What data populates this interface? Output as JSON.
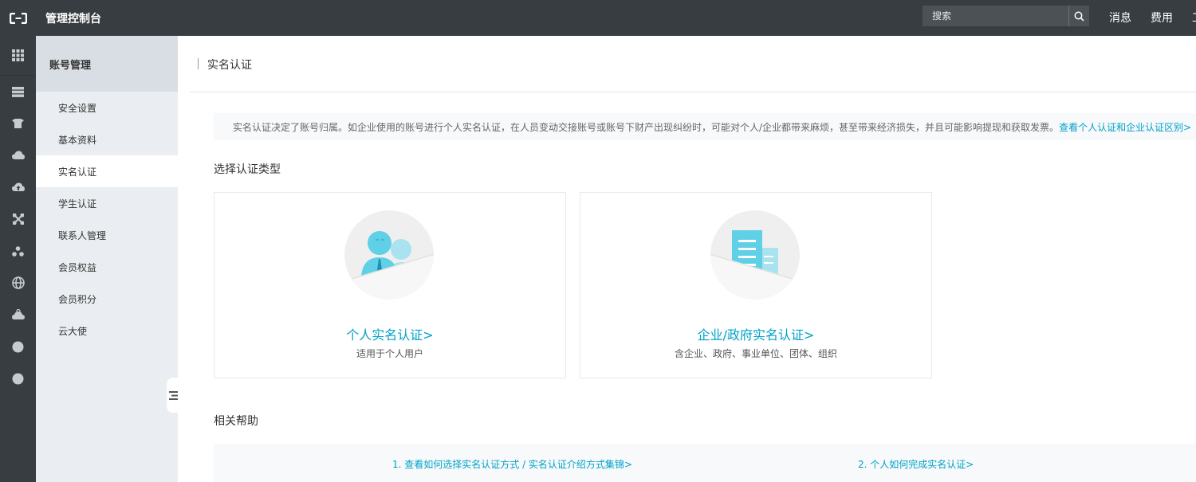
{
  "topbar": {
    "title": "管理控制台",
    "search": {
      "placeholder": "搜索"
    },
    "links": [
      "消息",
      "费用",
      "工"
    ]
  },
  "rail": {
    "icons": [
      "apps-grid-icon",
      "server-icon",
      "shield-icon",
      "cloud-icon",
      "cloud-upload-icon",
      "network-icon",
      "cluster-icon",
      "globe-icon",
      "gear-cloud-icon",
      "circle-icon",
      "circle-icon"
    ]
  },
  "subnav": {
    "header": "账号管理",
    "items": [
      "安全设置",
      "基本资料",
      "实名认证",
      "学生认证",
      "联系人管理",
      "会员权益",
      "会员积分",
      "云大使"
    ],
    "active_index": 2
  },
  "page": {
    "title": "实名认证",
    "notice_text": "实名认证决定了账号归属。如企业使用的账号进行个人实名认证，在人员变动交接账号或账号下财产出现纠纷时，可能对个人/企业都带来麻烦，甚至带来经济损失，并且可能影响提现和获取发票。",
    "notice_link": "查看个人认证和企业认证区别>",
    "choose_title": "选择认证类型",
    "cards": [
      {
        "title": "个人实名认证>",
        "desc": "适用于个人用户",
        "icon": "person-icon"
      },
      {
        "title": "企业/政府实名认证>",
        "desc": "含企业、政府、事业单位、团体、组织",
        "icon": "building-icon"
      }
    ],
    "help_title": "相关帮助",
    "help_links": [
      "1. 查看如何选择实名认证方式 / 实名认证介绍方式集锦>",
      "2. 个人如何完成实名认证>"
    ]
  },
  "colors": {
    "topbar": "#373d41",
    "accent": "#00a2ca",
    "subnav_bg": "#eaedf1"
  }
}
